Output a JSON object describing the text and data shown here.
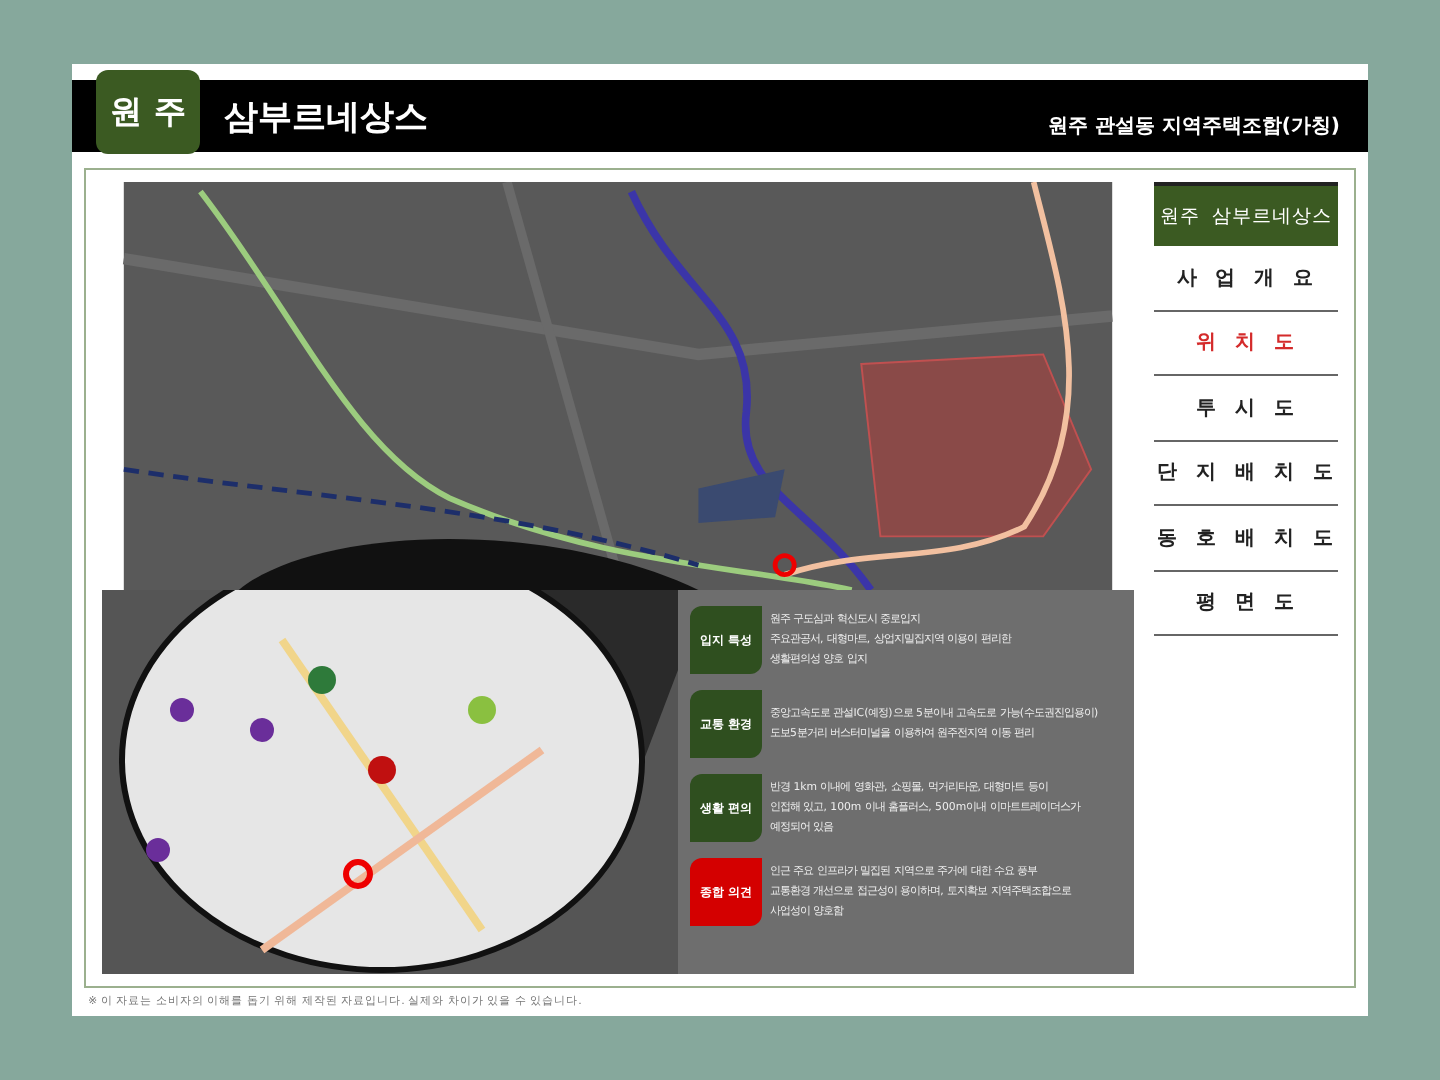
{
  "header": {
    "logo": "원 주",
    "title": "삼부르네상스",
    "subtitle": "원주 관설동 지역주택조합(가칭)"
  },
  "sidebar": {
    "title": "원주  삼부르네상스",
    "items": [
      {
        "label": "사 업 개 요",
        "selected": false
      },
      {
        "label": "위 치 도",
        "selected": true
      },
      {
        "label": "투 시 도",
        "selected": false
      },
      {
        "label": "단 지 배 치 도",
        "selected": false
      },
      {
        "label": "동 호 배 치 도",
        "selected": false
      },
      {
        "label": "평 면 도",
        "selected": false
      }
    ]
  },
  "features": [
    {
      "label": "입지 특성",
      "color": "#2f4f1f",
      "lines": [
        "원주 구도심과 혁신도시 중로입지",
        "주요관공서, 대형마트, 상업지밀집지역 이용이 편리한",
        "생활편의성 양호 입지"
      ]
    },
    {
      "label": "교통 환경",
      "color": "#2f4f1f",
      "lines": [
        "중앙고속도로 관설IC(예정)으로 5분이내 고속도로 가능(수도권진입용이)",
        "도보5분거리 버스터미널을 이용하여 원주전지역 이동 편리"
      ]
    },
    {
      "label": "생활 편의",
      "color": "#2f4f1f",
      "lines": [
        "반경 1km 이내에 영화관, 쇼핑몰, 먹거리타운, 대형마트 등이",
        "인접해 있고, 100m 이내 홈플러스, 500m이내 이마트트레이더스가",
        "예정되어 있음"
      ]
    },
    {
      "label": "종합 의견",
      "color": "#d40000",
      "lines": [
        "인근 주요 인프라가 밀집된 지역으로 주거에 대한 수요 풍부",
        "교통환경 개선으로 접근성이 용이하며, 토지확보 지역주택조합으로",
        "사업성이 양호함"
      ]
    }
  ],
  "footnote": "※ 이 자료는 소비자의 이해를 돕기 위해 제작된 자료입니다. 실제와 차이가 있을 수 있습니다."
}
